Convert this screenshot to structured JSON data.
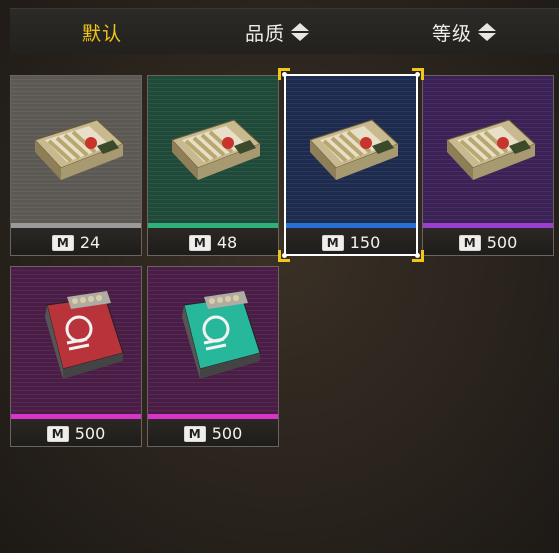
{
  "sort_tabs": [
    {
      "label": "默认",
      "active": true
    },
    {
      "label": "品质",
      "active": false
    },
    {
      "label": "等级",
      "active": false
    }
  ],
  "items": [
    {
      "price": "24",
      "quality_color": "#9a9a9a",
      "bg": "#5c5853",
      "kind": "ammo-box",
      "selected": false
    },
    {
      "price": "48",
      "quality_color": "#2fb27a",
      "bg": "#1f4a3a",
      "kind": "ammo-box",
      "selected": false
    },
    {
      "price": "150",
      "quality_color": "#2a6fd6",
      "bg": "#1d2b4e",
      "kind": "ammo-box",
      "selected": true
    },
    {
      "price": "500",
      "quality_color": "#9a3fd0",
      "bg": "#3b2156",
      "kind": "ammo-box",
      "selected": false
    },
    {
      "price": "500",
      "quality_color": "#d636c8",
      "bg": "#4a1d47",
      "kind": "biohazard-case-red",
      "selected": false
    },
    {
      "price": "500",
      "quality_color": "#d636c8",
      "bg": "#4a1d47",
      "kind": "biohazard-case-teal",
      "selected": false
    }
  ],
  "currency_icon": "m-coin-icon",
  "currency_letter": "M"
}
